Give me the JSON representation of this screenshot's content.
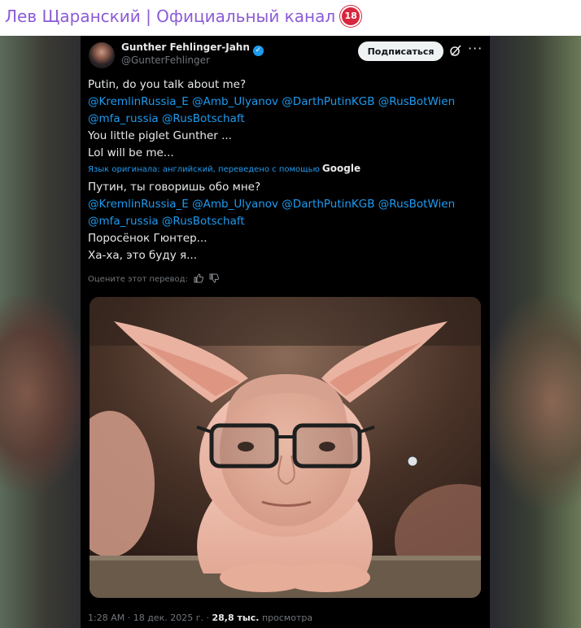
{
  "channel": {
    "title": "Лев Щаранский | Официальный канал",
    "badge": "18",
    "title_color": "#8b5bd6"
  },
  "tweet": {
    "author_name": "Gunther Fehlinger-Jahn",
    "handle": "@GunterFehlinger",
    "verified_icon": "verified-badge-icon",
    "subscribe_label": "Подписаться",
    "more_label": "···",
    "original": {
      "line1": "Putin, do you talk about me?",
      "mentions1": "@KremlinRussia_E @Amb_Ulyanov @DarthPutinKGB @RusBotWien",
      "mentions2": "@mfa_russia @RusBotschaft",
      "line2": "You little piglet Gunther ...",
      "line3": "Lol will be me..."
    },
    "translation_note": "Язык оригинала: английский, переведено с помощью",
    "translation_service": "Google",
    "translated": {
      "line1": "Путин, ты говоришь обо мне?",
      "mentions1": "@KremlinRussia_E @Amb_Ulyanov @DarthPutinKGB @RusBotWien",
      "mentions2": "@mfa_russia @RusBotschaft",
      "line2": "Поросёнок Гюнтер...",
      "line3": "Ха-ха, это буду я..."
    },
    "rate_label": "Оцените этот перевод:",
    "footer": {
      "time_date": "1:28 AM · 18 дек. 2025 г. ·",
      "views_count": "28,8 тыс.",
      "views_label": "просмотра"
    },
    "accent_color": "#1d9bf0"
  }
}
